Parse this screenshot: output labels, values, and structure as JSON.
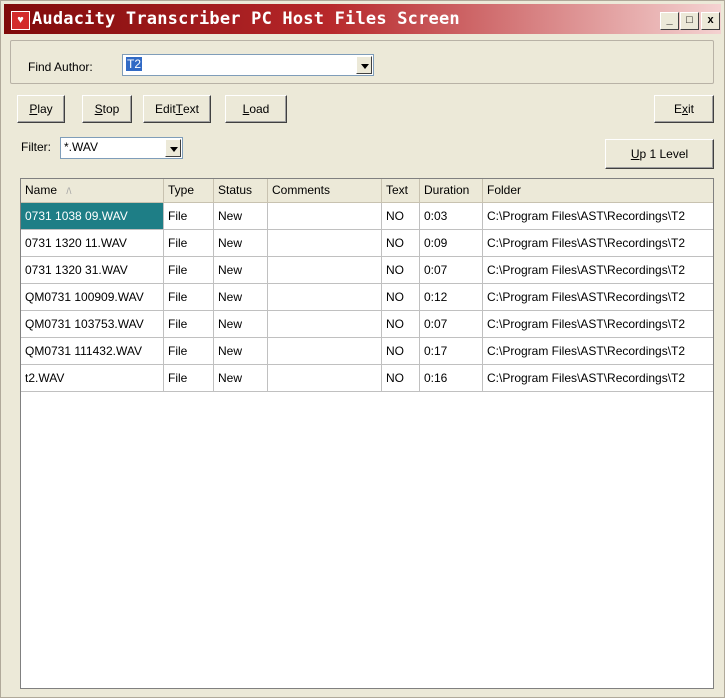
{
  "window": {
    "title": "Audacity Transcriber PC Host Files Screen",
    "controls": {
      "minimize": "_",
      "maximize": "□",
      "close": "x"
    }
  },
  "find_author": {
    "label": "Find Author:",
    "value": "T2"
  },
  "toolbar": {
    "play_mn": "P",
    "play_rest": "lay",
    "stop_mn": "S",
    "stop_rest": "top",
    "edit_pre": "Edit ",
    "edit_mn": "T",
    "edit_post": "ext",
    "load_mn": "L",
    "load_rest": "oad",
    "exit_pre": "E",
    "exit_mn": "x",
    "exit_post": "it",
    "up_mn": "U",
    "up_rest": "p 1 Level"
  },
  "filter": {
    "label": "Filter:",
    "value": "*.WAV"
  },
  "table": {
    "headers": [
      "Name",
      "Type",
      "Status",
      "Comments",
      "Text",
      "Duration",
      "Folder"
    ],
    "sort_indicator": "/\\",
    "rows": [
      [
        "0731 1038 09.WAV",
        "File",
        "New",
        "",
        "NO",
        "0:03",
        "C:\\Program Files\\AST\\Recordings\\T2"
      ],
      [
        "0731 1320 11.WAV",
        "File",
        "New",
        "",
        "NO",
        "0:09",
        "C:\\Program Files\\AST\\Recordings\\T2"
      ],
      [
        "0731 1320 31.WAV",
        "File",
        "New",
        "",
        "NO",
        "0:07",
        "C:\\Program Files\\AST\\Recordings\\T2"
      ],
      [
        "QM0731 100909.WAV",
        "File",
        "New",
        "",
        "NO",
        "0:12",
        "C:\\Program Files\\AST\\Recordings\\T2"
      ],
      [
        "QM0731 103753.WAV",
        "File",
        "New",
        "",
        "NO",
        "0:07",
        "C:\\Program Files\\AST\\Recordings\\T2"
      ],
      [
        "QM0731 111432.WAV",
        "File",
        "New",
        "",
        "NO",
        "0:17",
        "C:\\Program Files\\AST\\Recordings\\T2"
      ],
      [
        "t2.WAV",
        "File",
        "New",
        "",
        "NO",
        "0:16",
        "C:\\Program Files\\AST\\Recordings\\T2"
      ]
    ]
  }
}
